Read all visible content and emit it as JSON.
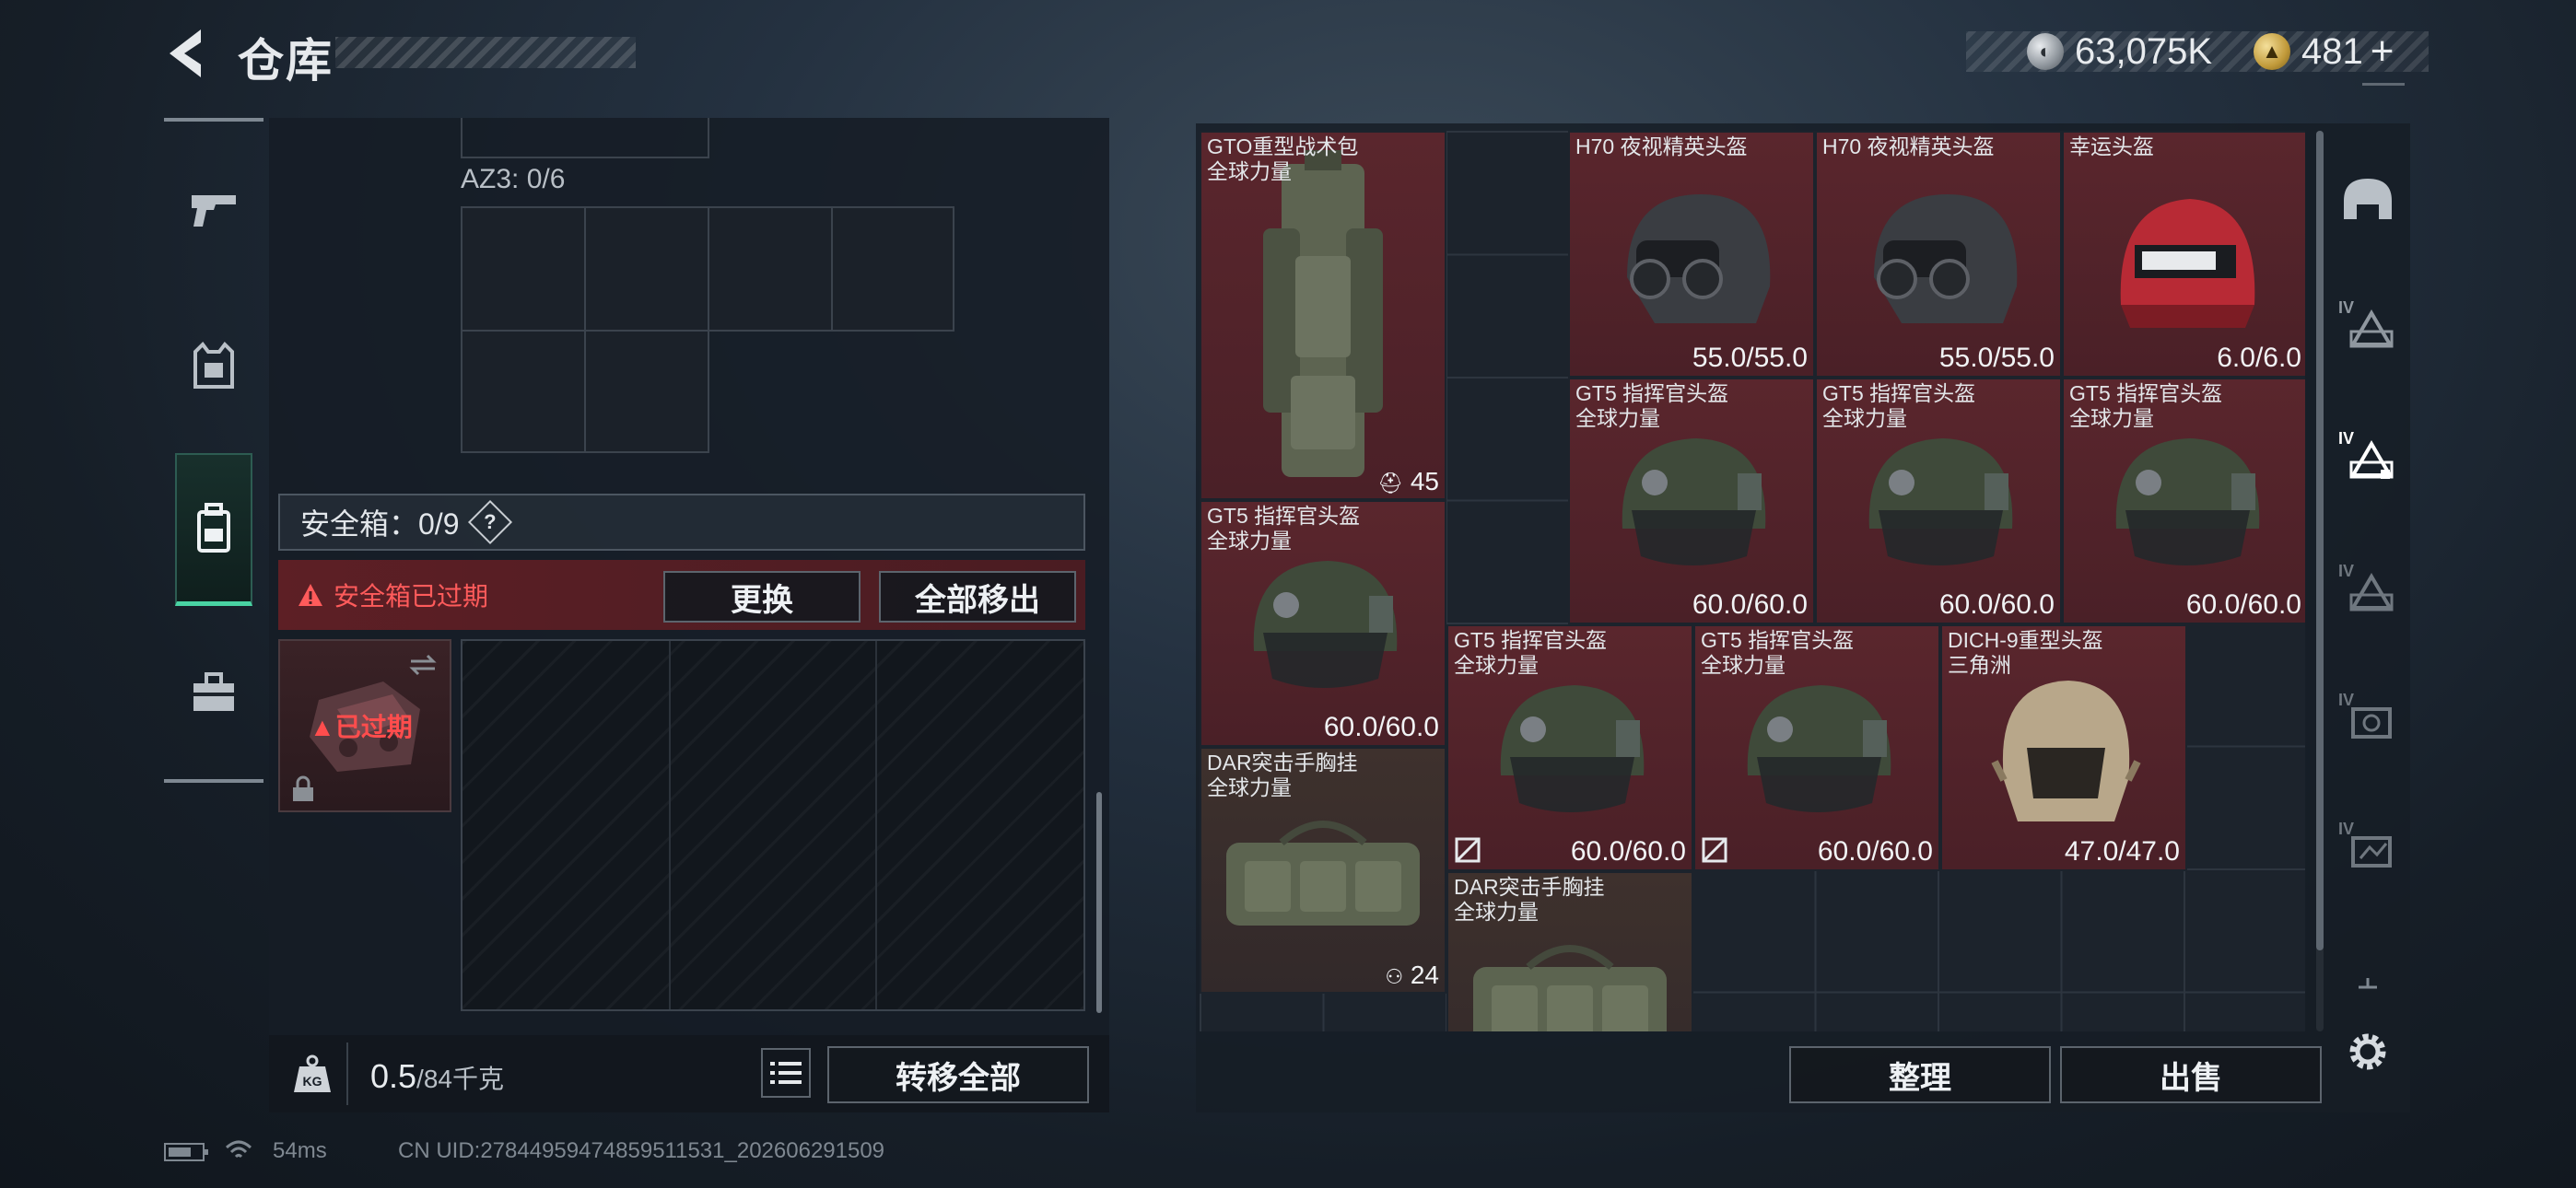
{
  "header": {
    "title": "仓库",
    "currency_silver": "63,075K",
    "currency_gold": "481",
    "currency_add": "+"
  },
  "left_rail": {
    "categories": [
      "weapon",
      "armor",
      "backpack",
      "supplies"
    ],
    "active": "backpack"
  },
  "container": {
    "az_label": "AZ3: 0/6"
  },
  "safe_box": {
    "label": "安全箱：0/9",
    "help": "?",
    "alert": "安全箱已过期",
    "replace_button": "更换",
    "move_all_out_button": "全部移出",
    "expired_badge": "已过期"
  },
  "bottom": {
    "weight_value": "0.5",
    "weight_capacity": "/84千克",
    "kg_icon_text": "KG",
    "transfer_all_button": "转移全部"
  },
  "inventory": {
    "items": [
      {
        "name": "GTO重型战术包",
        "sub": "全球力量",
        "value": "45",
        "color": "red"
      },
      {
        "name": "H70 夜视精英头盔",
        "sub": "",
        "value": "55.0/55.0",
        "color": "red"
      },
      {
        "name": "H70 夜视精英头盔",
        "sub": "",
        "value": "55.0/55.0",
        "color": "red"
      },
      {
        "name": "幸运头盔",
        "sub": "",
        "value": "6.0/6.0",
        "color": "red"
      },
      {
        "name": "GT5 指挥官头盔",
        "sub": "全球力量",
        "value": "60.0/60.0",
        "color": "red"
      },
      {
        "name": "GT5 指挥官头盔",
        "sub": "全球力量",
        "value": "60.0/60.0",
        "color": "red"
      },
      {
        "name": "GT5 指挥官头盔",
        "sub": "全球力量",
        "value": "60.0/60.0",
        "color": "red"
      },
      {
        "name": "GT5 指挥官头盔",
        "sub": "全球力量",
        "value": "60.0/60.0",
        "color": "red"
      },
      {
        "name": "GT5 指挥官头盔",
        "sub": "全球力量",
        "value": "60.0/60.0",
        "color": "red"
      },
      {
        "name": "GT5 指挥官头盔",
        "sub": "全球力量",
        "value": "60.0/60.0",
        "color": "red"
      },
      {
        "name": "DICH-9重型头盔",
        "sub": "三角洲",
        "value": "47.0/47.0",
        "color": "red"
      },
      {
        "name": "DAR突击手胸挂",
        "sub": "全球力量",
        "value": "24",
        "color": "brown"
      },
      {
        "name": "DAR突击手胸挂",
        "sub": "全球力量",
        "value": "",
        "color": "brown"
      }
    ],
    "sort_button": "整理",
    "sell_button": "出售"
  },
  "side_tabs": [
    "IV",
    "IV",
    "IV",
    "IV",
    "IV"
  ],
  "status": {
    "ping": "54ms",
    "uid": "CN UID:27844959474859511531_202606291509"
  },
  "colors": {
    "accent_green": "#49d3a3",
    "alert_red": "#ff5b5b",
    "item_red": "#5a262d"
  }
}
